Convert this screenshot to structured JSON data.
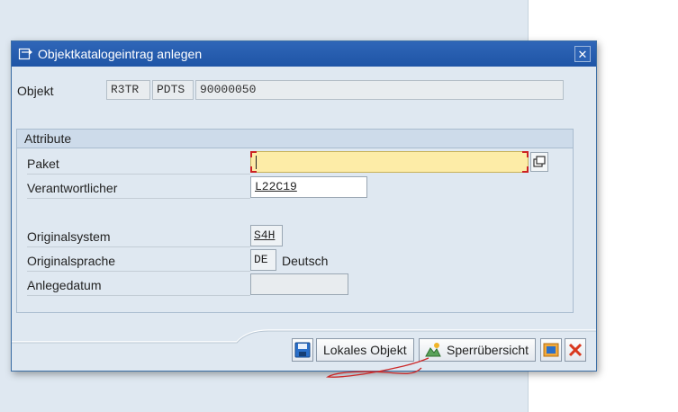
{
  "dialog": {
    "title": "Objektkatalogeintrag anlegen",
    "icons": {
      "title_icon": "create-entry-icon",
      "close": "close-icon"
    }
  },
  "object": {
    "label": "Objekt",
    "pgmid": "R3TR",
    "type": "PDTS",
    "name": "90000050"
  },
  "attributes": {
    "group_title": "Attribute",
    "package_label": "Paket",
    "package_value": "",
    "responsible_label": "Verantwortlicher",
    "responsible_value": "L22C19",
    "orig_system_label": "Originalsystem",
    "orig_system_value": "S4H",
    "orig_language_label": "Originalsprache",
    "orig_language_code": "DE",
    "orig_language_text": "Deutsch",
    "created_on_label": "Anlegedatum",
    "created_on_value": ""
  },
  "footer": {
    "save_icon": "save-icon",
    "local_object_label": "Lokales Objekt",
    "lock_overview_label": "Sperrübersicht",
    "lock_overview_icon": "lock-overview-icon",
    "other_icon": "transport-icon",
    "cancel_icon": "cancel-icon"
  },
  "colors": {
    "title_bar": "#2f66b8",
    "required_field": "#fdeca7",
    "cancel_red": "#d9381e"
  }
}
